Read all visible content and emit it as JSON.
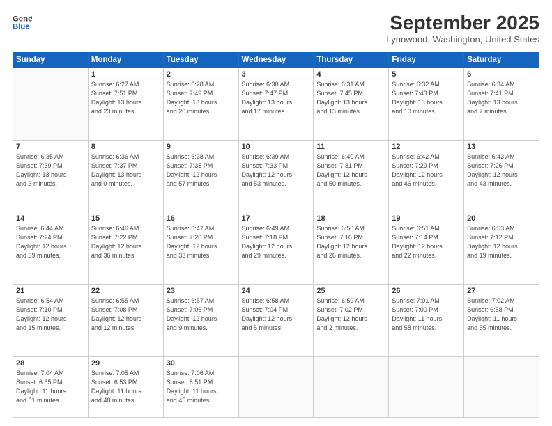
{
  "logo": {
    "line1": "General",
    "line2": "Blue"
  },
  "header": {
    "month": "September 2025",
    "location": "Lynnwood, Washington, United States"
  },
  "days_of_week": [
    "Sunday",
    "Monday",
    "Tuesday",
    "Wednesday",
    "Thursday",
    "Friday",
    "Saturday"
  ],
  "weeks": [
    [
      {
        "day": "",
        "info": ""
      },
      {
        "day": "1",
        "info": "Sunrise: 6:27 AM\nSunset: 7:51 PM\nDaylight: 13 hours\nand 23 minutes."
      },
      {
        "day": "2",
        "info": "Sunrise: 6:28 AM\nSunset: 7:49 PM\nDaylight: 13 hours\nand 20 minutes."
      },
      {
        "day": "3",
        "info": "Sunrise: 6:30 AM\nSunset: 7:47 PM\nDaylight: 13 hours\nand 17 minutes."
      },
      {
        "day": "4",
        "info": "Sunrise: 6:31 AM\nSunset: 7:45 PM\nDaylight: 13 hours\nand 13 minutes."
      },
      {
        "day": "5",
        "info": "Sunrise: 6:32 AM\nSunset: 7:43 PM\nDaylight: 13 hours\nand 10 minutes."
      },
      {
        "day": "6",
        "info": "Sunrise: 6:34 AM\nSunset: 7:41 PM\nDaylight: 13 hours\nand 7 minutes."
      }
    ],
    [
      {
        "day": "7",
        "info": "Sunrise: 6:35 AM\nSunset: 7:39 PM\nDaylight: 13 hours\nand 3 minutes."
      },
      {
        "day": "8",
        "info": "Sunrise: 6:36 AM\nSunset: 7:37 PM\nDaylight: 13 hours\nand 0 minutes."
      },
      {
        "day": "9",
        "info": "Sunrise: 6:38 AM\nSunset: 7:35 PM\nDaylight: 12 hours\nand 57 minutes."
      },
      {
        "day": "10",
        "info": "Sunrise: 6:39 AM\nSunset: 7:33 PM\nDaylight: 12 hours\nand 53 minutes."
      },
      {
        "day": "11",
        "info": "Sunrise: 6:40 AM\nSunset: 7:31 PM\nDaylight: 12 hours\nand 50 minutes."
      },
      {
        "day": "12",
        "info": "Sunrise: 6:42 AM\nSunset: 7:29 PM\nDaylight: 12 hours\nand 46 minutes."
      },
      {
        "day": "13",
        "info": "Sunrise: 6:43 AM\nSunset: 7:26 PM\nDaylight: 12 hours\nand 43 minutes."
      }
    ],
    [
      {
        "day": "14",
        "info": "Sunrise: 6:44 AM\nSunset: 7:24 PM\nDaylight: 12 hours\nand 39 minutes."
      },
      {
        "day": "15",
        "info": "Sunrise: 6:46 AM\nSunset: 7:22 PM\nDaylight: 12 hours\nand 36 minutes."
      },
      {
        "day": "16",
        "info": "Sunrise: 6:47 AM\nSunset: 7:20 PM\nDaylight: 12 hours\nand 33 minutes."
      },
      {
        "day": "17",
        "info": "Sunrise: 6:49 AM\nSunset: 7:18 PM\nDaylight: 12 hours\nand 29 minutes."
      },
      {
        "day": "18",
        "info": "Sunrise: 6:50 AM\nSunset: 7:16 PM\nDaylight: 12 hours\nand 26 minutes."
      },
      {
        "day": "19",
        "info": "Sunrise: 6:51 AM\nSunset: 7:14 PM\nDaylight: 12 hours\nand 22 minutes."
      },
      {
        "day": "20",
        "info": "Sunrise: 6:53 AM\nSunset: 7:12 PM\nDaylight: 12 hours\nand 19 minutes."
      }
    ],
    [
      {
        "day": "21",
        "info": "Sunrise: 6:54 AM\nSunset: 7:10 PM\nDaylight: 12 hours\nand 15 minutes."
      },
      {
        "day": "22",
        "info": "Sunrise: 6:55 AM\nSunset: 7:08 PM\nDaylight: 12 hours\nand 12 minutes."
      },
      {
        "day": "23",
        "info": "Sunrise: 6:57 AM\nSunset: 7:06 PM\nDaylight: 12 hours\nand 9 minutes."
      },
      {
        "day": "24",
        "info": "Sunrise: 6:58 AM\nSunset: 7:04 PM\nDaylight: 12 hours\nand 5 minutes."
      },
      {
        "day": "25",
        "info": "Sunrise: 6:59 AM\nSunset: 7:02 PM\nDaylight: 12 hours\nand 2 minutes."
      },
      {
        "day": "26",
        "info": "Sunrise: 7:01 AM\nSunset: 7:00 PM\nDaylight: 11 hours\nand 58 minutes."
      },
      {
        "day": "27",
        "info": "Sunrise: 7:02 AM\nSunset: 6:58 PM\nDaylight: 11 hours\nand 55 minutes."
      }
    ],
    [
      {
        "day": "28",
        "info": "Sunrise: 7:04 AM\nSunset: 6:55 PM\nDaylight: 11 hours\nand 51 minutes."
      },
      {
        "day": "29",
        "info": "Sunrise: 7:05 AM\nSunset: 6:53 PM\nDaylight: 11 hours\nand 48 minutes."
      },
      {
        "day": "30",
        "info": "Sunrise: 7:06 AM\nSunset: 6:51 PM\nDaylight: 11 hours\nand 45 minutes."
      },
      {
        "day": "",
        "info": ""
      },
      {
        "day": "",
        "info": ""
      },
      {
        "day": "",
        "info": ""
      },
      {
        "day": "",
        "info": ""
      }
    ]
  ]
}
